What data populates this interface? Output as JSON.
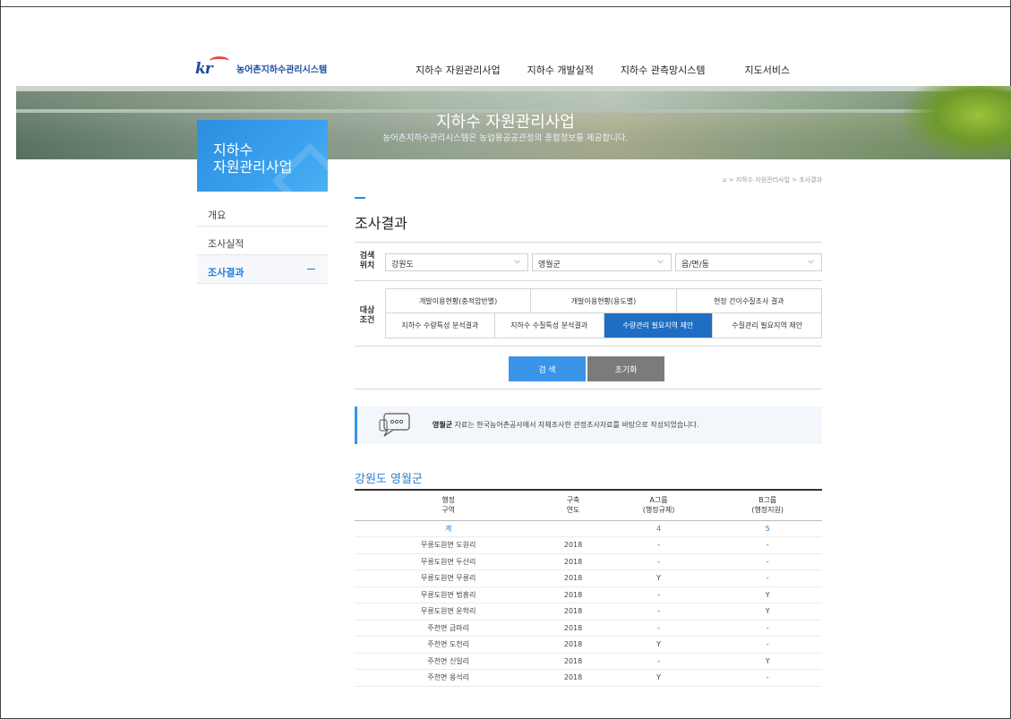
{
  "header": {
    "logo_text": "농어촌지하수관리시스템",
    "logo_mark": "kr",
    "nav": [
      "지하수 자원관리사업",
      "지하수 개발실적",
      "지하수 관측망시스템",
      "지도서비스"
    ]
  },
  "banner": {
    "title": "지하수 자원관리사업",
    "subtitle": "농어촌지하수관리시스템은 농업용공공관정의 종합정보를 제공합니다."
  },
  "side": {
    "box_title_1": "지하수",
    "box_title_2": "자원관리사업",
    "menu": [
      {
        "label": "개요"
      },
      {
        "label": "조사실적"
      },
      {
        "label": "조사결과",
        "active": true
      }
    ]
  },
  "breadcrumb": "⌂ > 지하수 자원관리사업 > 조사결과",
  "page_title": "조사결과",
  "filter": {
    "location_label": "검색\n위치",
    "location_label_1": "검색",
    "location_label_2": "위치",
    "selects": [
      {
        "value": "강원도"
      },
      {
        "value": "영월군"
      },
      {
        "value": "읍/면/동"
      }
    ],
    "condition_label_1": "대상",
    "condition_label_2": "조건",
    "conditions_row1": [
      "개발이용현황(충적암반별)",
      "개발이용현황(용도별)",
      "현장 간이수질조사 결과"
    ],
    "conditions_row2": [
      "지하수 수량특성 분석결과",
      "지하수 수질특성 분석결과",
      "수량관리 필요지역 제안",
      "수질관리 필요지역 제안"
    ],
    "selected_condition": "수량관리 필요지역 제안",
    "search_label": "검 색",
    "reset_label": "초기화"
  },
  "notice": {
    "bold": "영월군",
    "text": " 자료는 한국농어촌공사에서 자체조사한 관정조사자료를 바탕으로 작성되었습니다."
  },
  "result": {
    "region_title": "강원도 영월군",
    "headers": [
      {
        "l1": "행정",
        "l2": "구역"
      },
      {
        "l1": "구축",
        "l2": "연도"
      },
      {
        "l1": "A그룹",
        "l2": "(행정규제)"
      },
      {
        "l1": "B그룹",
        "l2": "(행정지원)"
      }
    ],
    "total": {
      "area": "계",
      "year": "",
      "a": "4",
      "b": "5"
    },
    "rows": [
      {
        "area": "무릉도원면 도원리",
        "year": "2018",
        "a": "-",
        "b": "-"
      },
      {
        "area": "무릉도원면 두산리",
        "year": "2018",
        "a": "-",
        "b": "-"
      },
      {
        "area": "무릉도원면 무릉리",
        "year": "2018",
        "a": "Y",
        "b": "-"
      },
      {
        "area": "무릉도원면 법흥리",
        "year": "2018",
        "a": "-",
        "b": "Y"
      },
      {
        "area": "무릉도원면 운학리",
        "year": "2018",
        "a": "-",
        "b": "Y"
      },
      {
        "area": "주천면 금마리",
        "year": "2018",
        "a": "-",
        "b": "-"
      },
      {
        "area": "주천면 도천리",
        "year": "2018",
        "a": "Y",
        "b": "-"
      },
      {
        "area": "주천면 신일리",
        "year": "2018",
        "a": "-",
        "b": "Y"
      },
      {
        "area": "주천면 용석리",
        "year": "2018",
        "a": "Y",
        "b": "-"
      }
    ]
  },
  "colors": {
    "accent": "#2a8ce0",
    "selected_tab": "#1e6fc4",
    "reset_button": "#7b7b7b",
    "logo_red": "#e54b4b"
  }
}
